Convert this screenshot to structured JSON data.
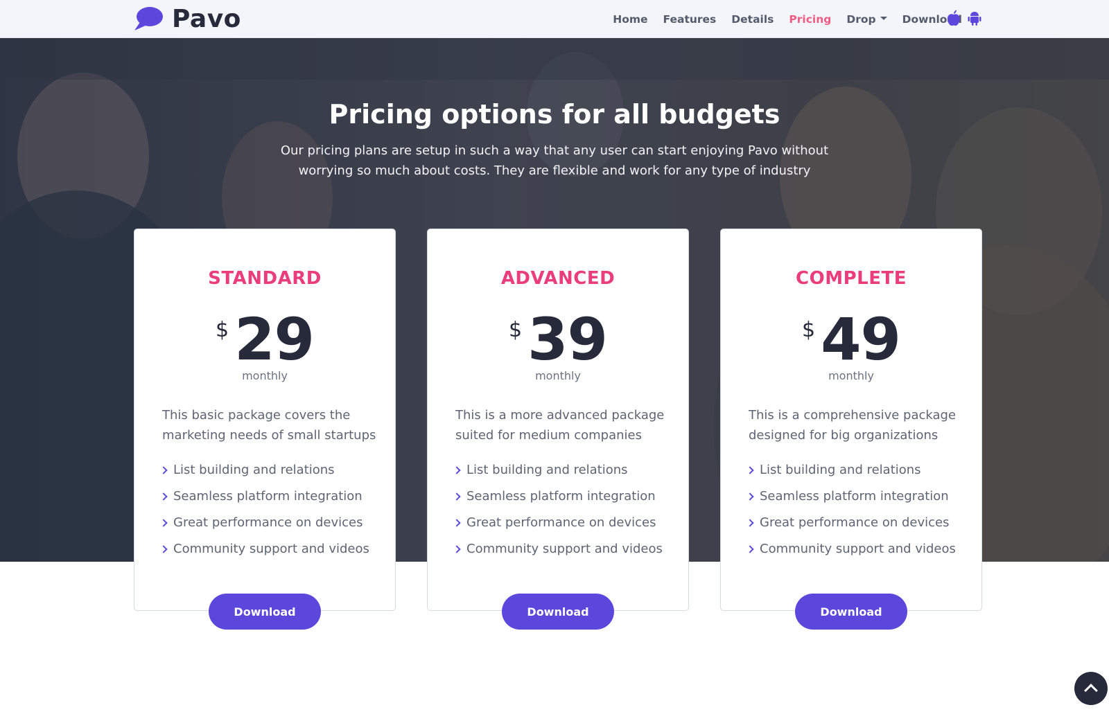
{
  "brand": {
    "name": "Pavo",
    "logo_icon": "speech-bubble-icon",
    "accent": "#5b47dc"
  },
  "nav": {
    "items": [
      {
        "label": "Home"
      },
      {
        "label": "Features"
      },
      {
        "label": "Details"
      },
      {
        "label": "Pricing",
        "active": true
      },
      {
        "label": "Drop"
      },
      {
        "label": "Download"
      }
    ],
    "store_icons": [
      "apple-icon",
      "android-icon"
    ],
    "active_color": "#f25c83"
  },
  "hero": {
    "title": "Pricing options for all budgets",
    "subtitle": "Our pricing plans are setup in such a way that any user can start enjoying Pavo without worrying so much about costs. They are flexible and work for any type of industry"
  },
  "plans": [
    {
      "name": "STANDARD",
      "currency": "$",
      "price": "29",
      "period": "monthly",
      "description": "This basic package covers the marketing needs of small startups",
      "features": [
        "List building and relations",
        "Seamless platform integration",
        "Great performance on devices",
        "Community support and videos"
      ],
      "button": "Download"
    },
    {
      "name": "ADVANCED",
      "currency": "$",
      "price": "39",
      "period": "monthly",
      "description": "This is a more advanced package suited for medium companies",
      "features": [
        "List building and relations",
        "Seamless platform integration",
        "Great performance on devices",
        "Community support and videos"
      ],
      "button": "Download"
    },
    {
      "name": "COMPLETE",
      "currency": "$",
      "price": "49",
      "period": "monthly",
      "description": "This is a comprehensive package designed for big organizations",
      "features": [
        "List building and relations",
        "Seamless platform integration",
        "Great performance on devices",
        "Community support and videos"
      ],
      "button": "Download"
    }
  ],
  "colors": {
    "plan_title": "#ea3e7b",
    "button": "#5b47dc",
    "dark": "#262a3b"
  },
  "back_to_top_icon": "chevron-up-icon"
}
